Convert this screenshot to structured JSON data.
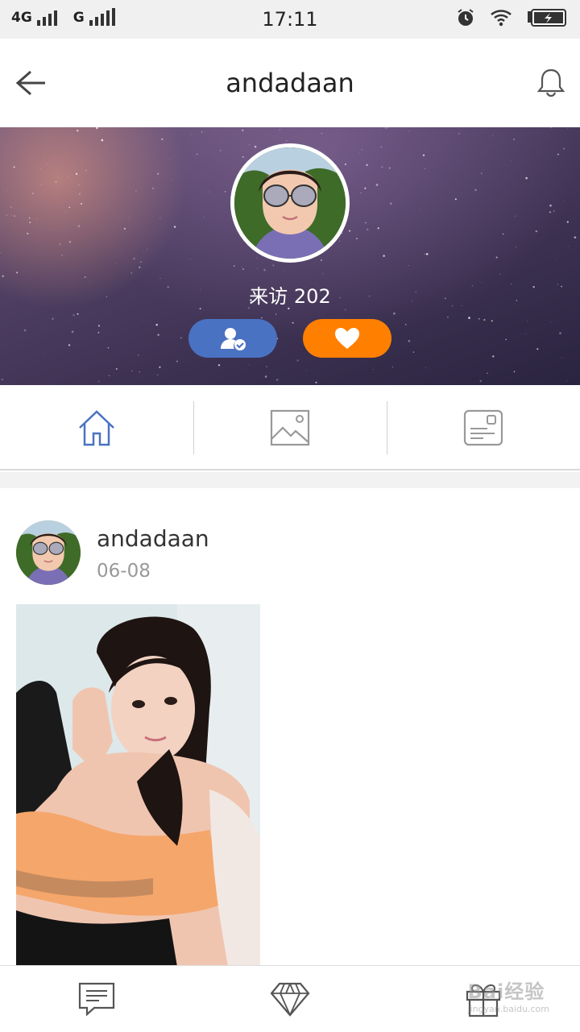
{
  "status_bar": {
    "network_1": "4G",
    "network_2": "G",
    "time": "17:11",
    "icons": [
      "signal-icon",
      "alarm-icon",
      "wifi-icon",
      "battery-charging-icon"
    ]
  },
  "header": {
    "title": "andadaan",
    "back_icon": "arrow-left-icon",
    "bell_icon": "bell-icon"
  },
  "profile": {
    "visits": "来访 202",
    "follow_icon": "user-check-icon",
    "like_icon": "heart-icon",
    "colors": {
      "follow": "#4a72c2",
      "like": "#ff8000"
    }
  },
  "tabs": [
    {
      "icon": "home-icon",
      "active": true
    },
    {
      "icon": "image-icon",
      "active": false
    },
    {
      "icon": "profile-card-icon",
      "active": false
    }
  ],
  "post": {
    "author": "andadaan",
    "date": "06-08"
  },
  "bottom_nav": [
    {
      "icon": "message-icon"
    },
    {
      "icon": "diamond-icon"
    },
    {
      "icon": "gift-icon"
    }
  ],
  "watermark": {
    "brand": "Bai经验",
    "url": "jingyan.baidu.com"
  },
  "colors": {
    "accent": "#4a72c2",
    "orange": "#ff8000"
  }
}
